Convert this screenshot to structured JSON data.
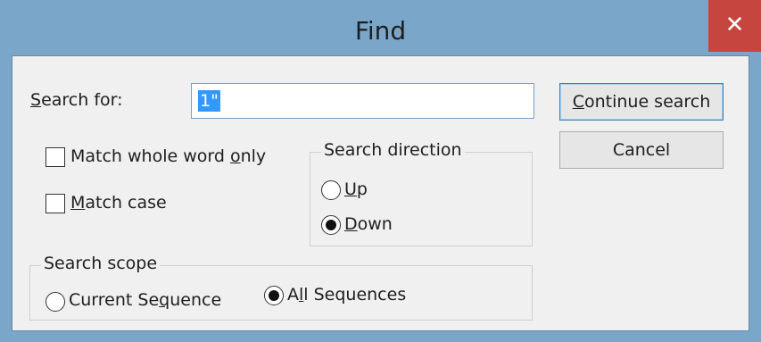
{
  "window": {
    "title": "Find",
    "close_symbol": "✕"
  },
  "search": {
    "label_accel": "S",
    "label_rest": "earch for:",
    "value": "1\""
  },
  "options": {
    "match_whole_word_pre": "Match whole word ",
    "match_whole_word_accel": "o",
    "match_whole_word_post": "nly",
    "match_whole_word_checked": false,
    "match_case_accel": "M",
    "match_case_rest": "atch case",
    "match_case_checked": false
  },
  "direction": {
    "legend": "Search direction",
    "up_accel": "U",
    "up_rest": "p",
    "down_accel": "D",
    "down_rest": "own",
    "selected": "Down"
  },
  "scope": {
    "legend": "Search scope",
    "current_pre": "Current Se",
    "current_accel": "q",
    "current_post": "uence",
    "all_pre": "A",
    "all_accel": "l",
    "all_post": "l Sequences",
    "selected": "All Sequences"
  },
  "buttons": {
    "continue_accel": "C",
    "continue_rest": "ontinue search",
    "cancel": "Cancel"
  }
}
